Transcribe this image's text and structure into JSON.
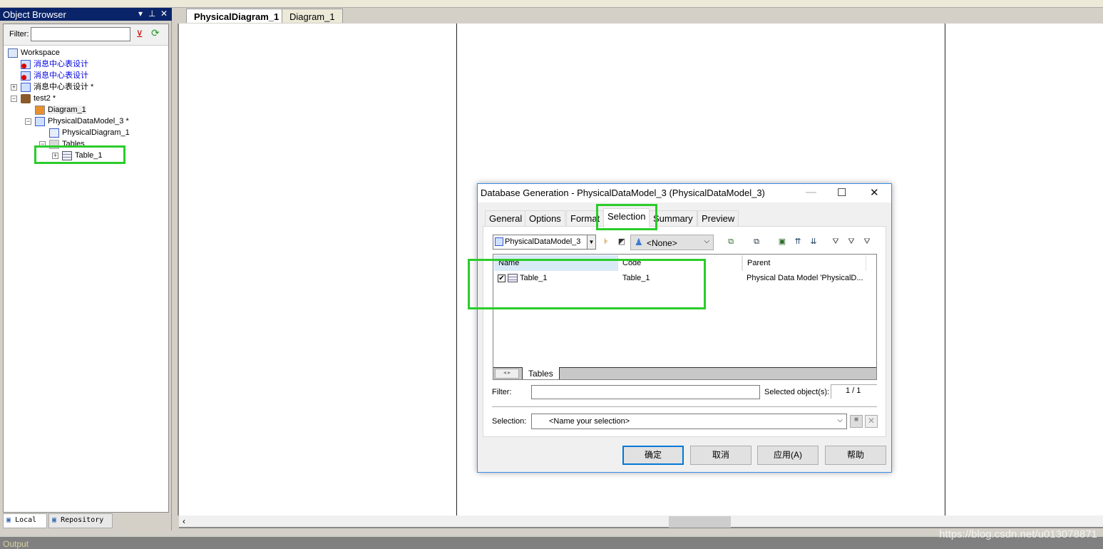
{
  "object_browser": {
    "title": "Object Browser",
    "filter_label": "Filter:",
    "filter_value": "",
    "tree": [
      {
        "label": "Workspace",
        "icon": "workspace-icon"
      },
      {
        "label": "消息中心表设计",
        "icon": "model-error-icon",
        "color": "#0000e0"
      },
      {
        "label": "消息中心表设计",
        "icon": "model-error-icon",
        "color": "#0000e0"
      },
      {
        "label": "消息中心表设计 *",
        "icon": "model-icon"
      },
      {
        "label": "test2 *",
        "icon": "project-briefcase-icon"
      },
      {
        "label": "Diagram_1",
        "icon": "diagram-icon"
      },
      {
        "label": "PhysicalDataModel_3 *",
        "icon": "physical-model-icon"
      },
      {
        "label": "PhysicalDiagram_1",
        "icon": "physical-diagram-icon"
      },
      {
        "label": "Tables",
        "icon": "folder-icon"
      },
      {
        "label": "Table_1",
        "icon": "table-icon"
      }
    ],
    "bottom_tabs": [
      "Local",
      "Repository"
    ]
  },
  "doc_tabs": [
    "PhysicalDiagram_1",
    "Diagram_1"
  ],
  "output_label": "Output",
  "watermark": "https://blog.csdn.net/u013078871",
  "dialog": {
    "title": "Database Generation - PhysicalDataModel_3 (PhysicalDataModel_3)",
    "tabs": [
      "General",
      "Options",
      "Format",
      "Selection",
      "Summary",
      "Preview"
    ],
    "active_tab": "Selection",
    "model_select": "PhysicalDataModel_3",
    "owner_select": "<None>",
    "columns": [
      "Name",
      "Code",
      "Parent"
    ],
    "rows": [
      {
        "checked": true,
        "name": "Table_1",
        "code": "Table_1",
        "parent": "Physical Data Model 'PhysicalD..."
      }
    ],
    "sheet_tab": "Tables",
    "filter_label": "Filter:",
    "filter_value": "",
    "selected_label": "Selected object(s):",
    "selected_count": "1 / 1",
    "selection_label": "Selection:",
    "selection_placeholder": "<Name your selection>",
    "buttons": {
      "ok": "确定",
      "cancel": "取消",
      "apply": "应用(A)",
      "help": "帮助"
    }
  },
  "colors": {
    "highlight": "#2bcc2b",
    "panel_header": "#0a246a",
    "dialog_border": "#3a8ee6"
  }
}
